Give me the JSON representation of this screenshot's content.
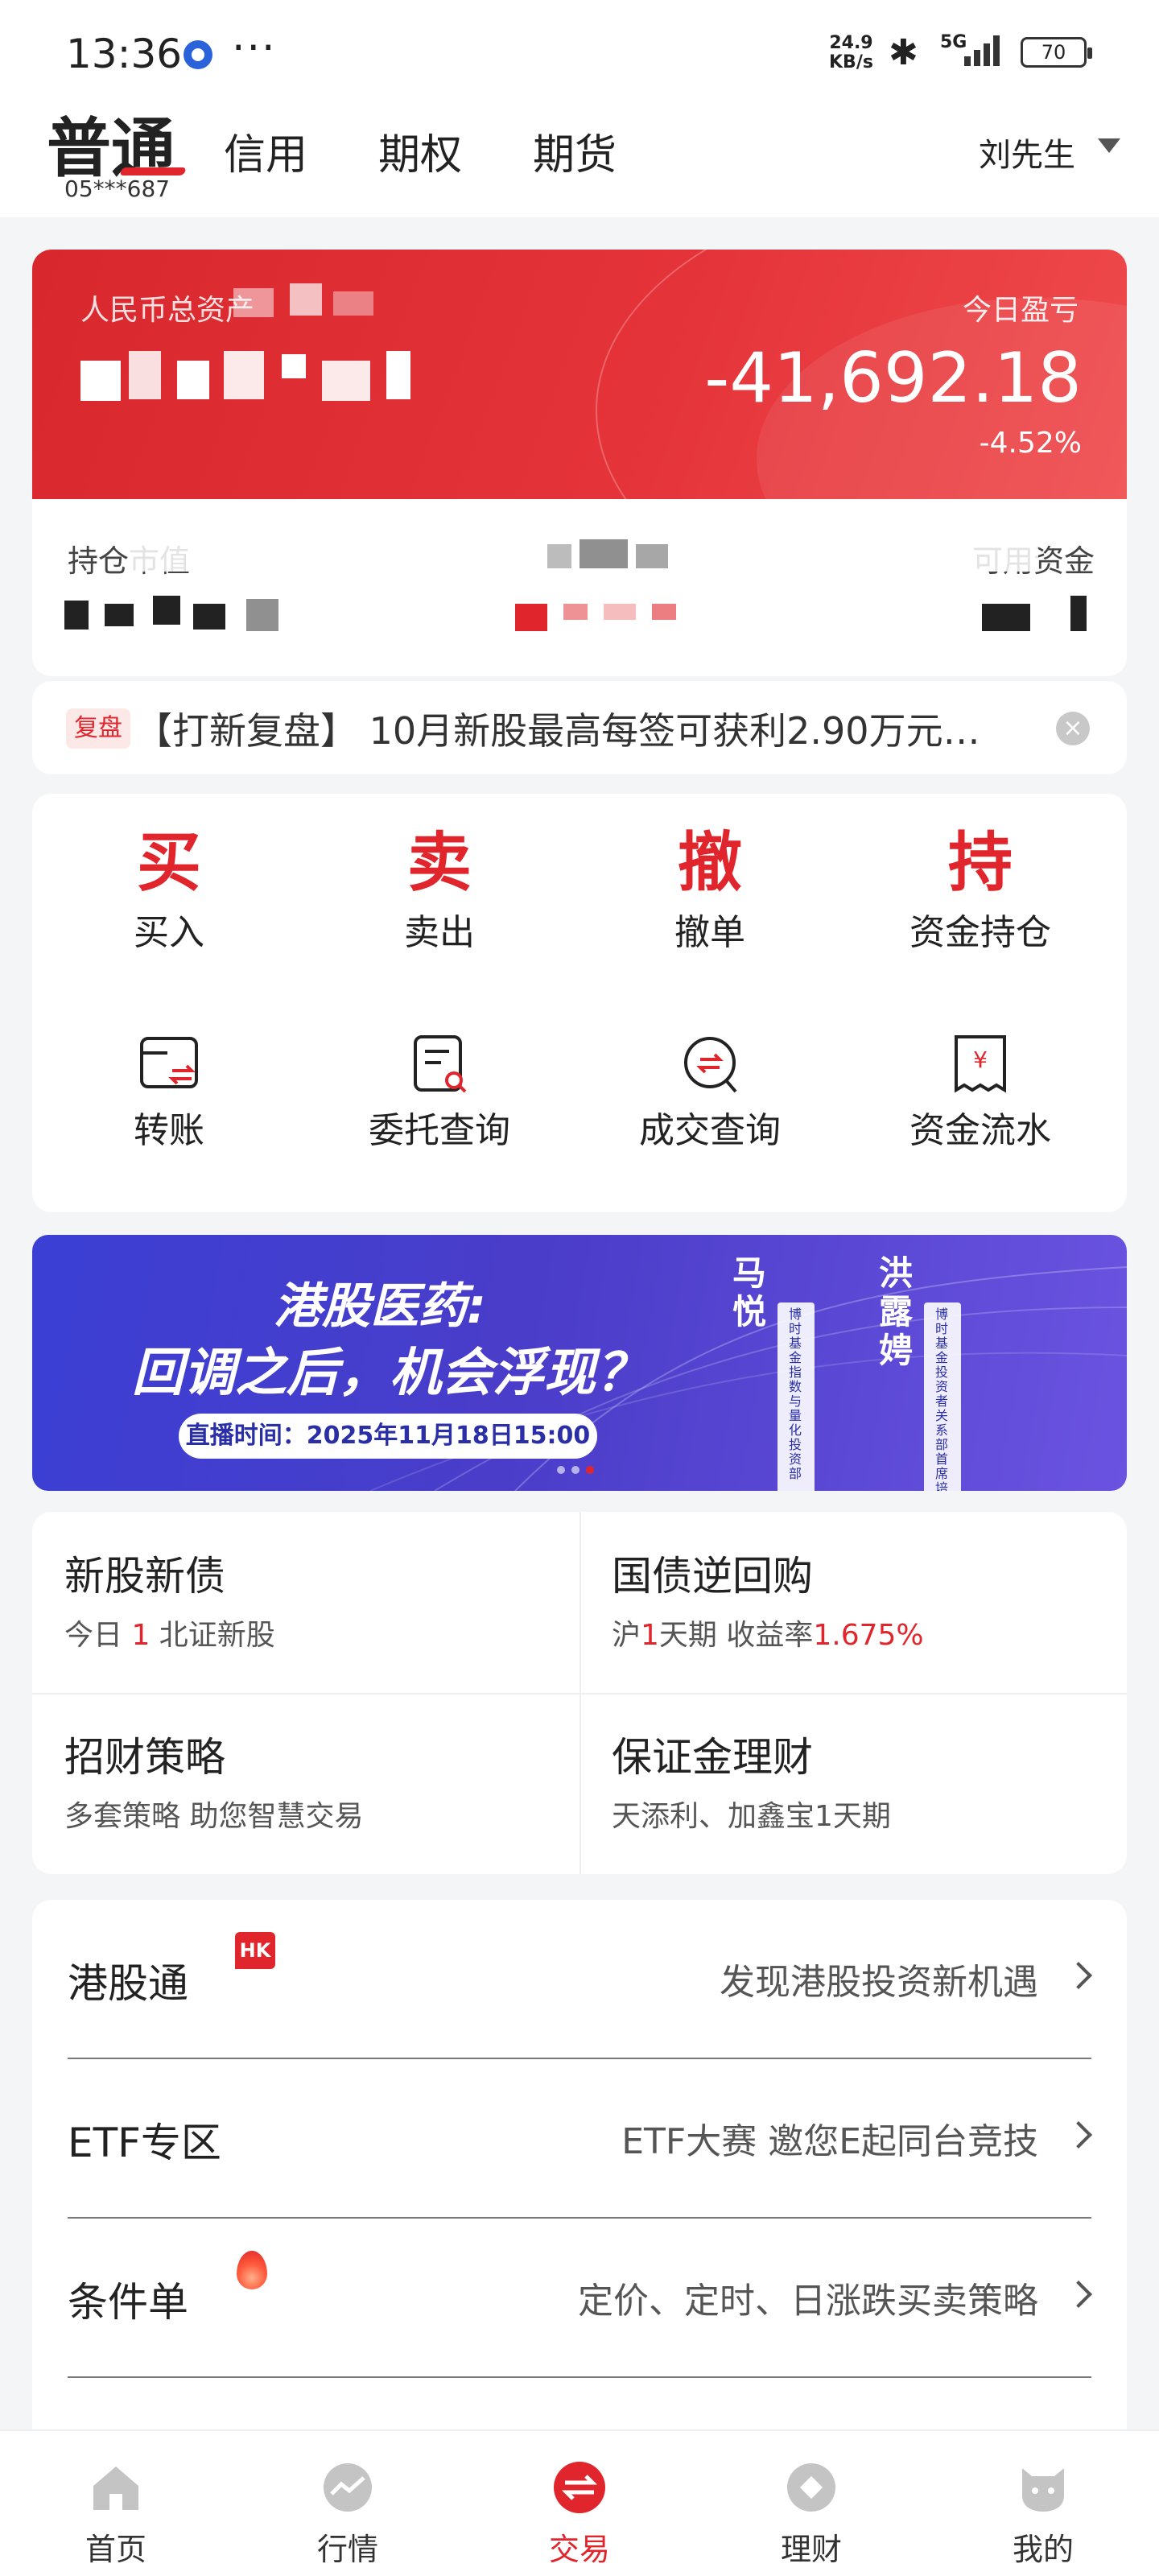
{
  "status_bar": {
    "time": "13:36",
    "dots": "···",
    "net_speed_value": "24.9",
    "net_speed_unit": "KB/s",
    "signal_label": "5G",
    "battery": "70"
  },
  "header": {
    "tabs": [
      "普通",
      "信用",
      "期权",
      "期货"
    ],
    "account": "05***687",
    "user": "刘先生"
  },
  "asset_card": {
    "total_label": "人民币总资产",
    "today_pl_label": "今日盈亏",
    "today_pl_value": "-41,692.18",
    "today_pl_pct": "-4.52%",
    "position_label": "持仓市值",
    "available_label": "可用资金"
  },
  "notice": {
    "badge": "复盘",
    "text": "【打新复盘】 10月新股最高每签可获利2.90万元…",
    "close": "×"
  },
  "quick_actions": [
    {
      "glyph": "买",
      "label": "买入"
    },
    {
      "glyph": "卖",
      "label": "卖出"
    },
    {
      "glyph": "撤",
      "label": "撤单"
    },
    {
      "glyph": "持",
      "label": "资金持仓"
    }
  ],
  "tools": [
    {
      "label": "转账",
      "icon": "transfer-icon"
    },
    {
      "label": "委托查询",
      "icon": "order-query-icon"
    },
    {
      "label": "成交查询",
      "icon": "deal-query-icon"
    },
    {
      "label": "资金流水",
      "icon": "fund-flow-icon"
    }
  ],
  "banner": {
    "title1": "港股医药:",
    "title2": "回调之后，机会浮现？",
    "pill": "直播时间：2025年11月18日15:00",
    "person1": "马悦",
    "person2": "洪露娉",
    "person1_title": "博时基金指数与量化投资部",
    "person2_title": "博时基金投资者关系部首席培训官"
  },
  "grid": [
    {
      "title": "新股新债",
      "sub_pre": "今日 ",
      "sub_hl": "1",
      "sub_post": " 北证新股"
    },
    {
      "title": "国债逆回购",
      "sub_pre": "沪",
      "sub_hl": "1",
      "sub_mid": "天期 收益率",
      "sub_hl2": "1.675%"
    },
    {
      "title": "招财策略",
      "sub": "多套策略 助您智慧交易"
    },
    {
      "title": "保证金理财",
      "sub": "天添利、加鑫宝1天期"
    }
  ],
  "list": [
    {
      "title": "港股通",
      "badge": "HK",
      "desc": "发现港股投资新机遇"
    },
    {
      "title": "ETF专区",
      "desc": "ETF大赛 邀您E起同台竞技"
    },
    {
      "title": "条件单",
      "desc": "定价、定时、日涨跌买卖策略"
    }
  ],
  "nav": [
    {
      "label": "首页",
      "icon": "home-icon"
    },
    {
      "label": "行情",
      "icon": "market-icon"
    },
    {
      "label": "交易",
      "icon": "trade-icon"
    },
    {
      "label": "理财",
      "icon": "wealth-icon"
    },
    {
      "label": "我的",
      "icon": "profile-icon"
    }
  ],
  "colors": {
    "accent": "#e0262c",
    "banner": "#3b3fd4"
  }
}
